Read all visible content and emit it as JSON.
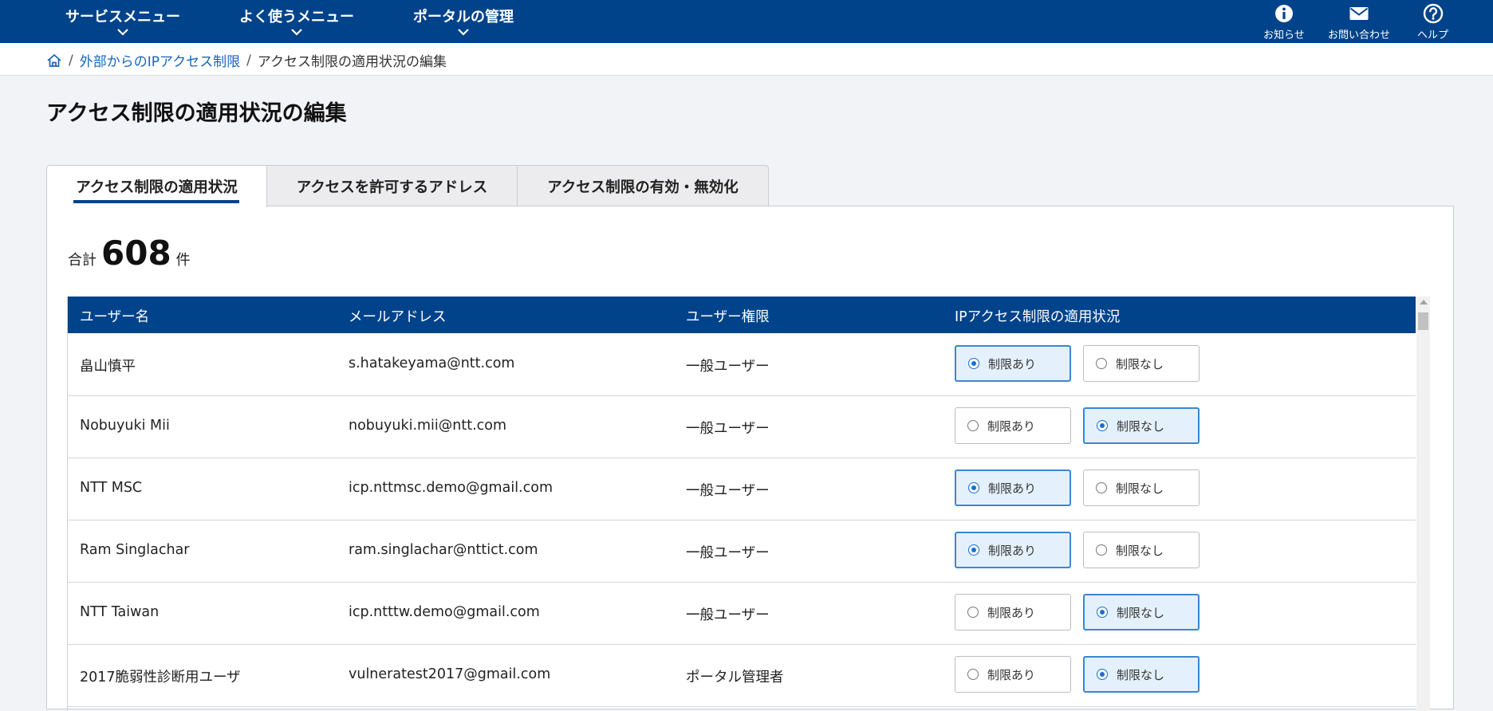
{
  "nav": {
    "menus": [
      "サービスメニュー",
      "よく使うメニュー",
      "ポータルの管理"
    ],
    "utilities": [
      {
        "label": "お知らせ",
        "icon": "info-icon"
      },
      {
        "label": "お問い合わせ",
        "icon": "mail-icon"
      },
      {
        "label": "ヘルプ",
        "icon": "help-icon"
      }
    ]
  },
  "breadcrumb": {
    "parent": "外部からのIPアクセス制限",
    "current": "アクセス制限の適用状況の編集",
    "separator": "/"
  },
  "page_title": "アクセス制限の適用状況の編集",
  "tabs": [
    "アクセス制限の適用状況",
    "アクセスを許可するアドレス",
    "アクセス制限の有効・無効化"
  ],
  "summary": {
    "prefix": "合計",
    "count": "608",
    "suffix": "件"
  },
  "table": {
    "headers": [
      "ユーザー名",
      "メールアドレス",
      "ユーザー権限",
      "IPアクセス制限の適用状況"
    ],
    "option_restricted": "制限あり",
    "option_unrestricted": "制限なし",
    "rows": [
      {
        "name": "畠山慎平",
        "email": "s.hatakeyama@ntt.com",
        "role": "一般ユーザー",
        "restricted": true
      },
      {
        "name": "Nobuyuki Mii",
        "email": "nobuyuki.mii@ntt.com",
        "role": "一般ユーザー",
        "restricted": false
      },
      {
        "name": "NTT MSC",
        "email": "icp.nttmsc.demo@gmail.com",
        "role": "一般ユーザー",
        "restricted": true
      },
      {
        "name": "Ram Singlachar",
        "email": "ram.singlachar@nttict.com",
        "role": "一般ユーザー",
        "restricted": true
      },
      {
        "name": "NTT Taiwan",
        "email": "icp.ntttw.demo@gmail.com",
        "role": "一般ユーザー",
        "restricted": false
      },
      {
        "name": "2017脆弱性診断用ユーザ",
        "email": "vulneratest2017@gmail.com",
        "role": "ポータル管理者",
        "restricted": false
      }
    ]
  },
  "colors": {
    "brand": "#00438b",
    "selected_bg": "#e4f1fc",
    "selected_border": "#3a86d4",
    "link": "#1565c0"
  }
}
